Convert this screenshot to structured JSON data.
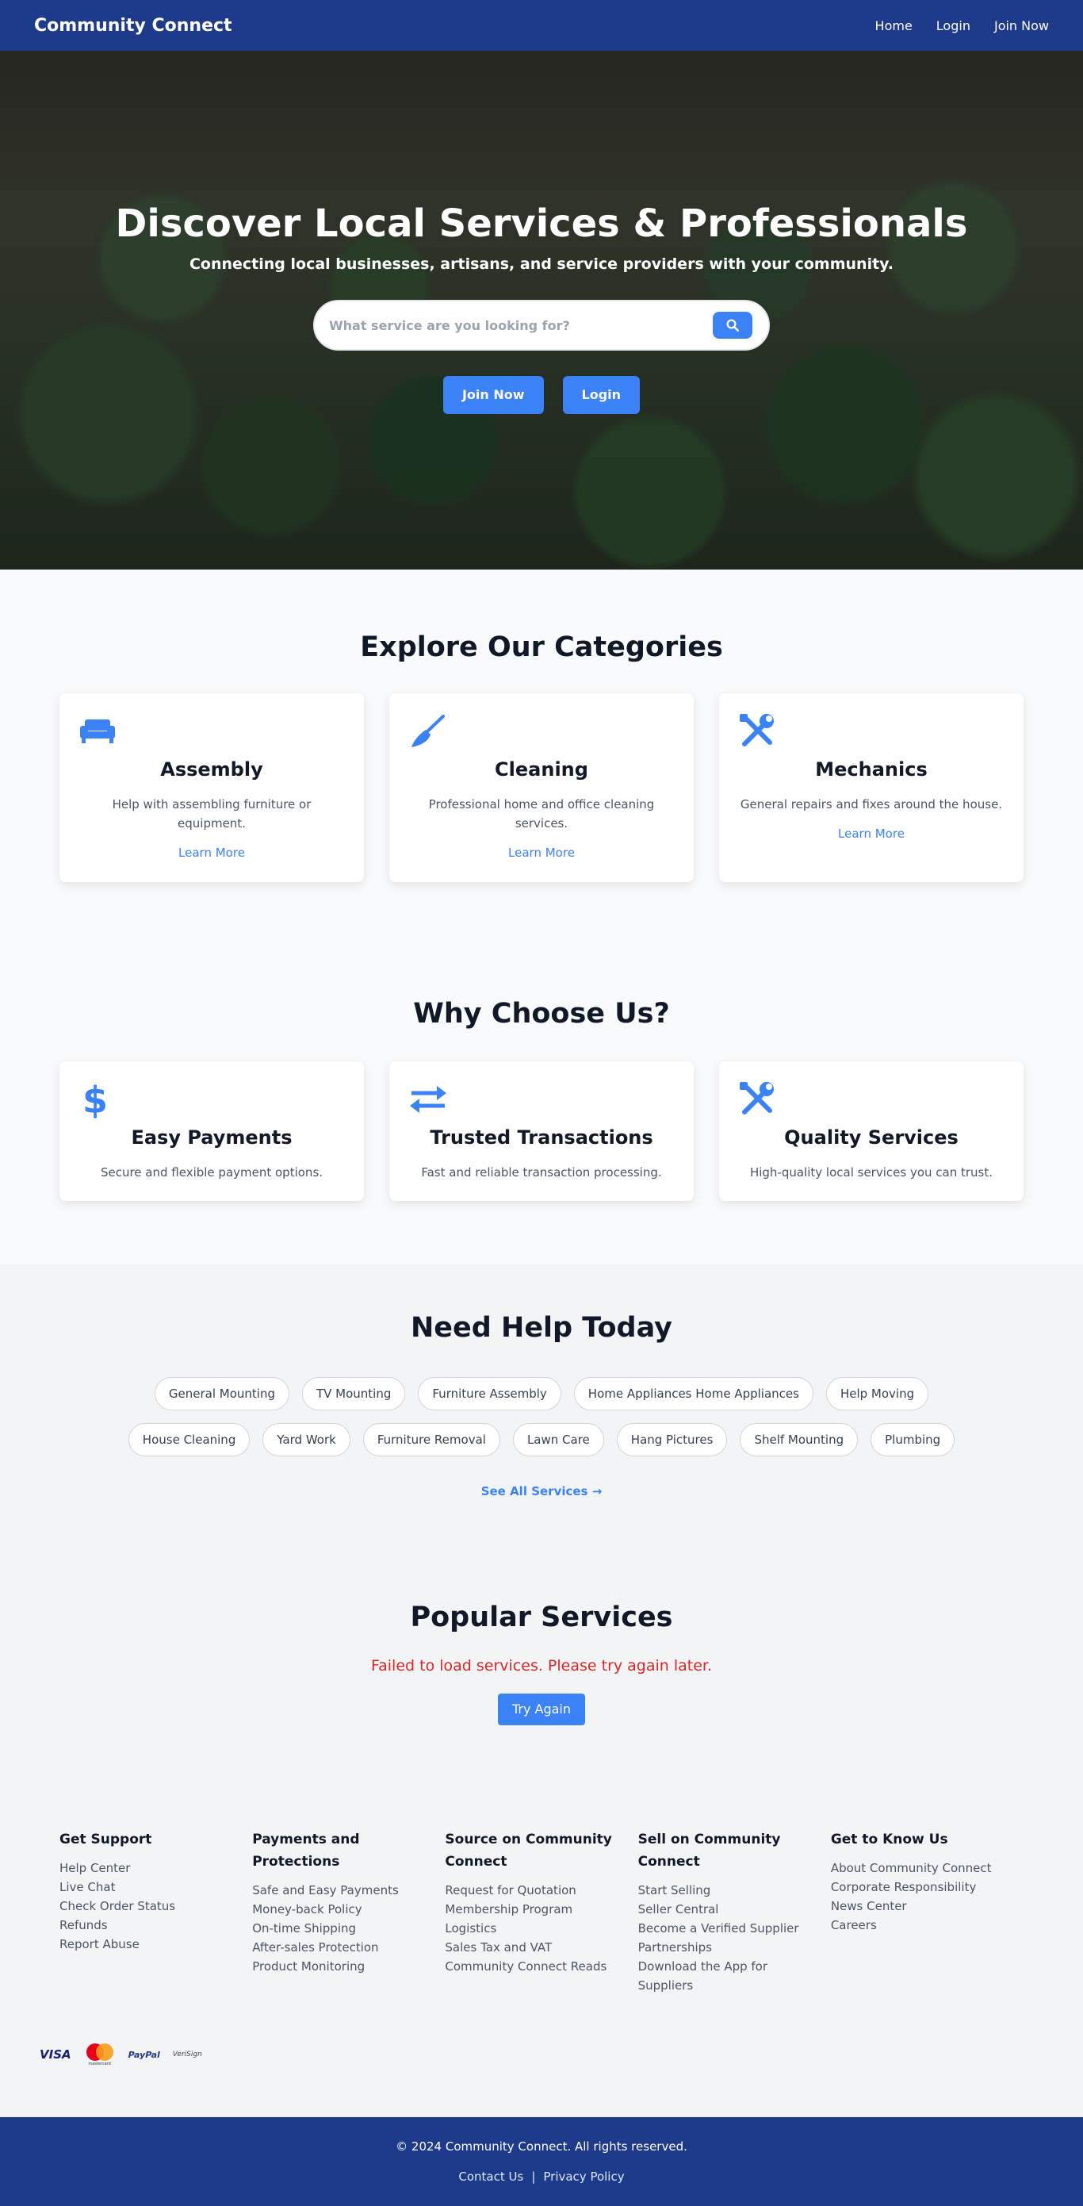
{
  "nav": {
    "brand": "Community Connect",
    "links": [
      "Home",
      "Login",
      "Join Now"
    ]
  },
  "hero": {
    "title": "Discover Local Services & Professionals",
    "subtitle": "Connecting local businesses, artisans, and service providers with your community.",
    "search_placeholder": "What service are you looking for?",
    "join_label": "Join Now",
    "login_label": "Login"
  },
  "categories": {
    "title": "Explore Our Categories",
    "items": [
      {
        "icon": "couch-icon",
        "name": "Assembly",
        "desc": "Help with assembling furniture or equipment.",
        "link": "Learn More"
      },
      {
        "icon": "broom-icon",
        "name": "Cleaning",
        "desc": "Professional home and office cleaning services.",
        "link": "Learn More"
      },
      {
        "icon": "tools-icon",
        "name": "Mechanics",
        "desc": "General repairs and fixes around the house.",
        "link": "Learn More"
      }
    ]
  },
  "why": {
    "title": "Why Choose Us?",
    "items": [
      {
        "icon": "dollar-icon",
        "name": "Easy Payments",
        "desc": "Secure and flexible payment options."
      },
      {
        "icon": "exchange-icon",
        "name": "Trusted Transactions",
        "desc": "Fast and reliable transaction processing."
      },
      {
        "icon": "tools-icon",
        "name": "Quality Services",
        "desc": "High-quality local services you can trust."
      }
    ]
  },
  "help": {
    "title": "Need Help Today",
    "tags": [
      "General Mounting",
      "TV Mounting",
      "Furniture Assembly",
      "Home Appliances Home Appliances",
      "Help Moving",
      "House Cleaning",
      "Yard Work",
      "Furniture Removal",
      "Lawn Care",
      "Hang Pictures",
      "Shelf Mounting",
      "Plumbing"
    ],
    "see_all": "See All Services →"
  },
  "popular": {
    "title": "Popular Services",
    "error": "Failed to load services. Please try again later.",
    "retry": "Try Again"
  },
  "footer": {
    "columns": [
      {
        "title": "Get Support",
        "links": [
          "Help Center",
          "Live Chat",
          "Check Order Status",
          "Refunds",
          "Report Abuse"
        ]
      },
      {
        "title": "Payments and Protections",
        "links": [
          "Safe and Easy Payments",
          "Money-back Policy",
          "On-time Shipping",
          "After-sales Protection",
          "Product Monitoring"
        ]
      },
      {
        "title": "Source on Community Connect",
        "links": [
          "Request for Quotation",
          "Membership Program",
          "Logistics",
          "Sales Tax and VAT",
          "Community Connect Reads"
        ]
      },
      {
        "title": "Sell on Community Connect",
        "links": [
          "Start Selling",
          "Seller Central",
          "Become a Verified Supplier",
          "Partnerships",
          "Download the App for Suppliers"
        ]
      },
      {
        "title": "Get to Know Us",
        "links": [
          "About Community Connect",
          "Corporate Responsibility",
          "News Center",
          "Careers"
        ]
      }
    ],
    "payments": [
      "VISA",
      "mastercard",
      "PayPal",
      "VeriSign"
    ],
    "copyright": "© 2024 Community Connect. All rights reserved.",
    "bottom_links": [
      "Contact Us",
      "Privacy Policy"
    ],
    "separator": "|"
  },
  "colors": {
    "primary": "#1e3a8a",
    "accent": "#3b82f6",
    "error": "#dc2626"
  }
}
